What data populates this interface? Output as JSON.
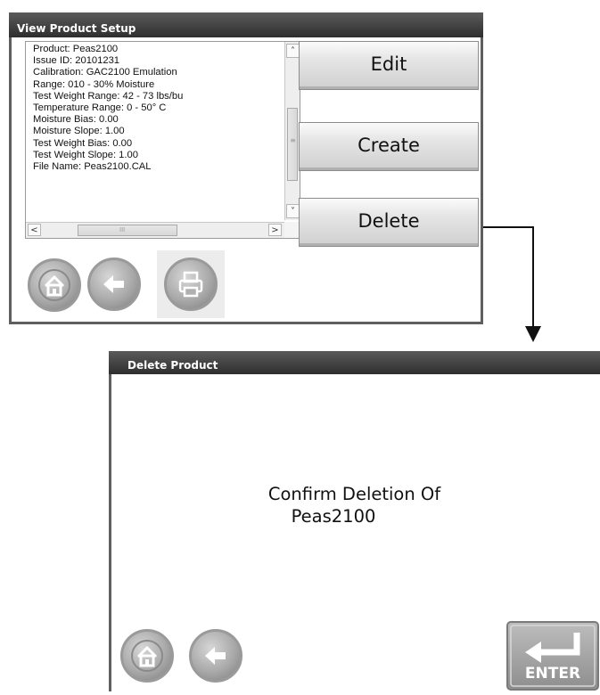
{
  "view_window": {
    "title": "View Product Setup",
    "product_info": [
      "Product: Peas2100",
      "Issue ID:  20101231",
      "Calibration: GAC2100 Emulation",
      "Range: 010 - 30% Moisture",
      "Test Weight Range:  42 - 73 lbs/bu",
      "Temperature Range: 0 - 50°  C",
      "Moisture Bias: 0.00",
      "Moisture Slope: 1.00",
      "Test Weight Bias: 0.00",
      "Test Weight Slope: 1.00",
      "File Name: Peas2100.CAL"
    ],
    "buttons": {
      "edit": "Edit",
      "create": "Create",
      "delete": "Delete"
    },
    "scroll_glyphs": {
      "up": "˄",
      "down": "˅",
      "left": "<",
      "right": ">",
      "grip": "≡",
      "hgrip": "III"
    },
    "icons": [
      "home-icon",
      "back-icon",
      "print-icon"
    ]
  },
  "delete_window": {
    "title": "Delete Product",
    "confirm_line1": "Confirm Deletion Of",
    "confirm_line2": "Peas2100",
    "enter_label": "ENTER",
    "icons": [
      "home-icon",
      "back-icon",
      "enter-icon"
    ]
  }
}
